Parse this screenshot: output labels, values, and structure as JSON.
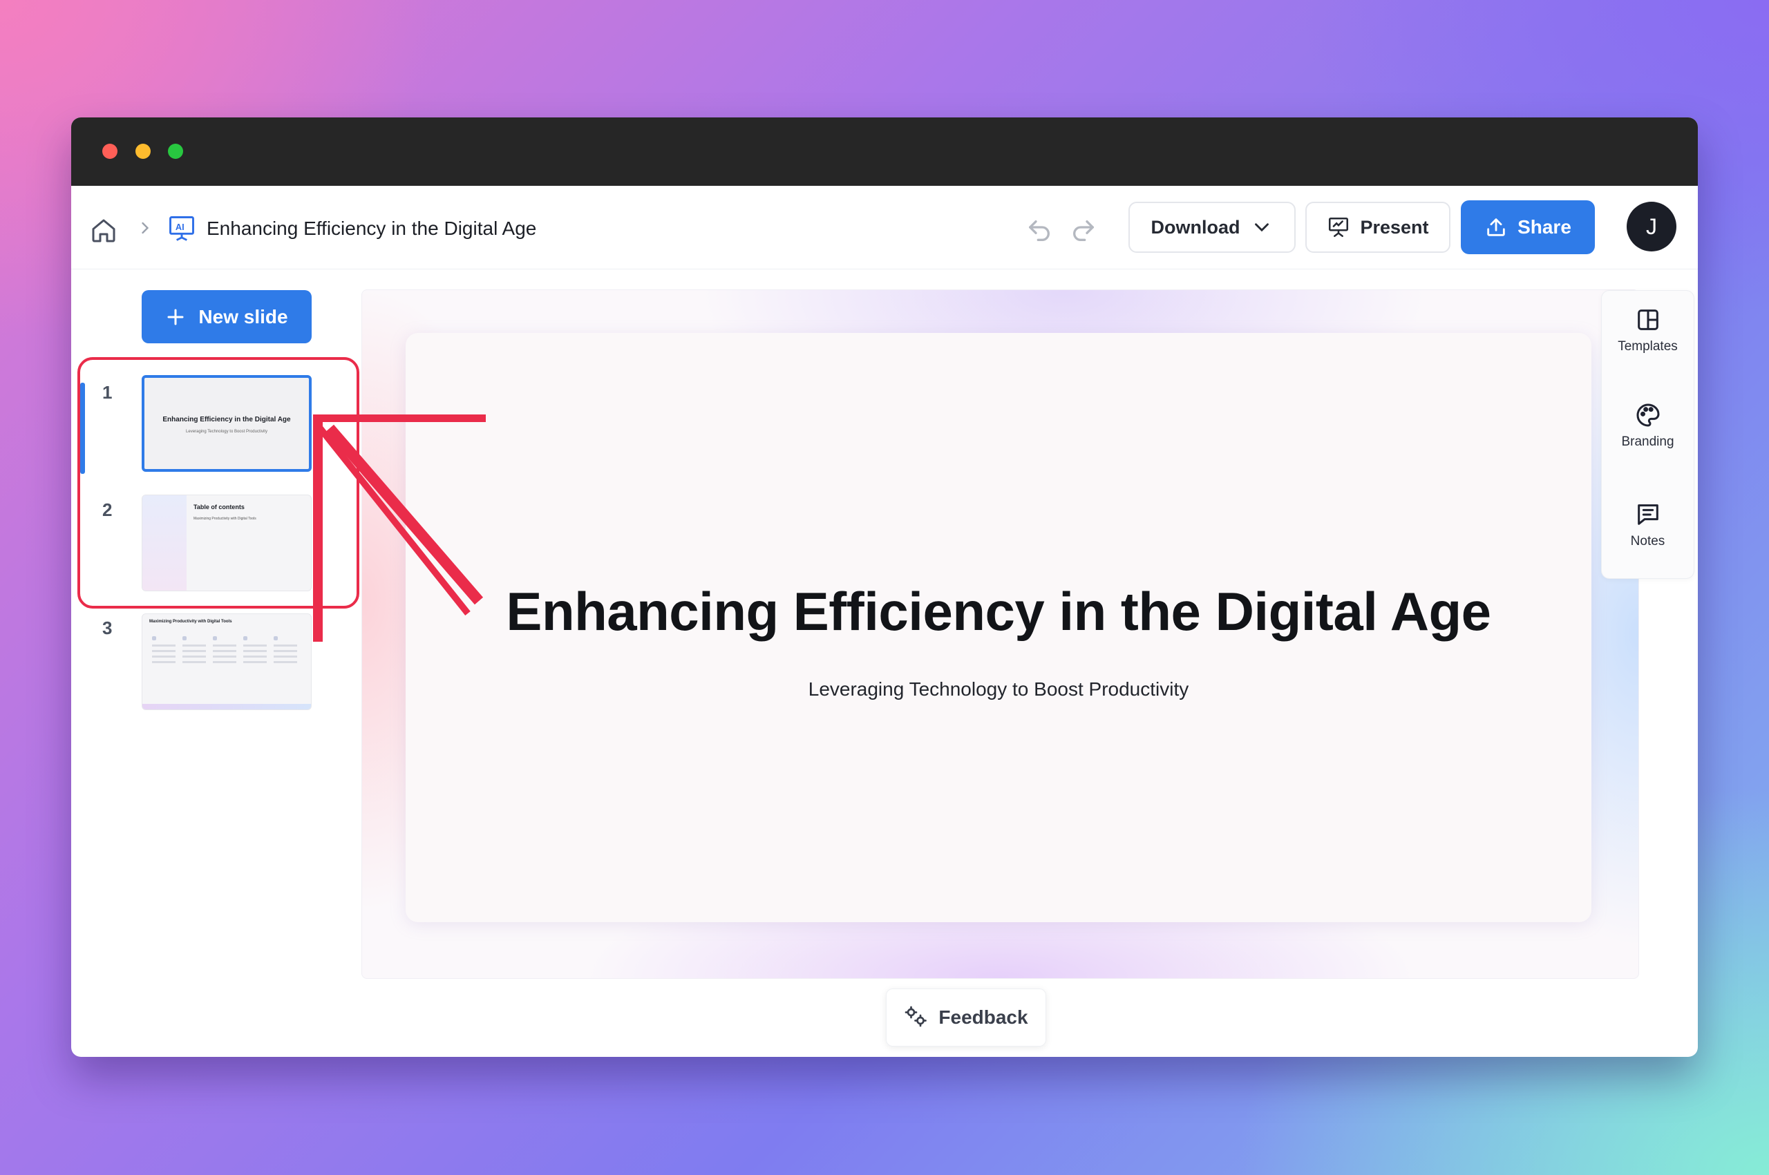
{
  "toolbar": {
    "doc_title": "Enhancing Efficiency in the Digital Age",
    "download_label": "Download",
    "present_label": "Present",
    "share_label": "Share",
    "avatar_initial": "J"
  },
  "sidebar": {
    "new_slide_label": "New slide",
    "slides": [
      {
        "number": "1",
        "title": "Enhancing Efficiency in the Digital Age",
        "subtitle": "Leveraging Technology to Boost Productivity"
      },
      {
        "number": "2",
        "title": "Table of contents",
        "line": "Maximizing Productivity with Digital Tools"
      },
      {
        "number": "3",
        "title": "Maximizing Productivity with Digital Tools"
      }
    ]
  },
  "slide": {
    "title": "Enhancing Efficiency in the Digital Age",
    "subtitle": "Leveraging Technology to Boost Productivity"
  },
  "right_rail": {
    "templates_label": "Templates",
    "branding_label": "Branding",
    "notes_label": "Notes"
  },
  "feedback_label": "Feedback",
  "colors": {
    "accent": "#2f7be8",
    "annotation": "#ea2c4a",
    "titlebar": "#262626"
  },
  "icons": [
    "home-icon",
    "chevron-right-icon",
    "ai-presentation-icon",
    "undo-icon",
    "redo-icon",
    "chevron-down-icon",
    "presentation-icon",
    "upload-icon",
    "plus-icon",
    "templates-icon",
    "palette-icon",
    "notes-icon",
    "feedback-icon"
  ]
}
